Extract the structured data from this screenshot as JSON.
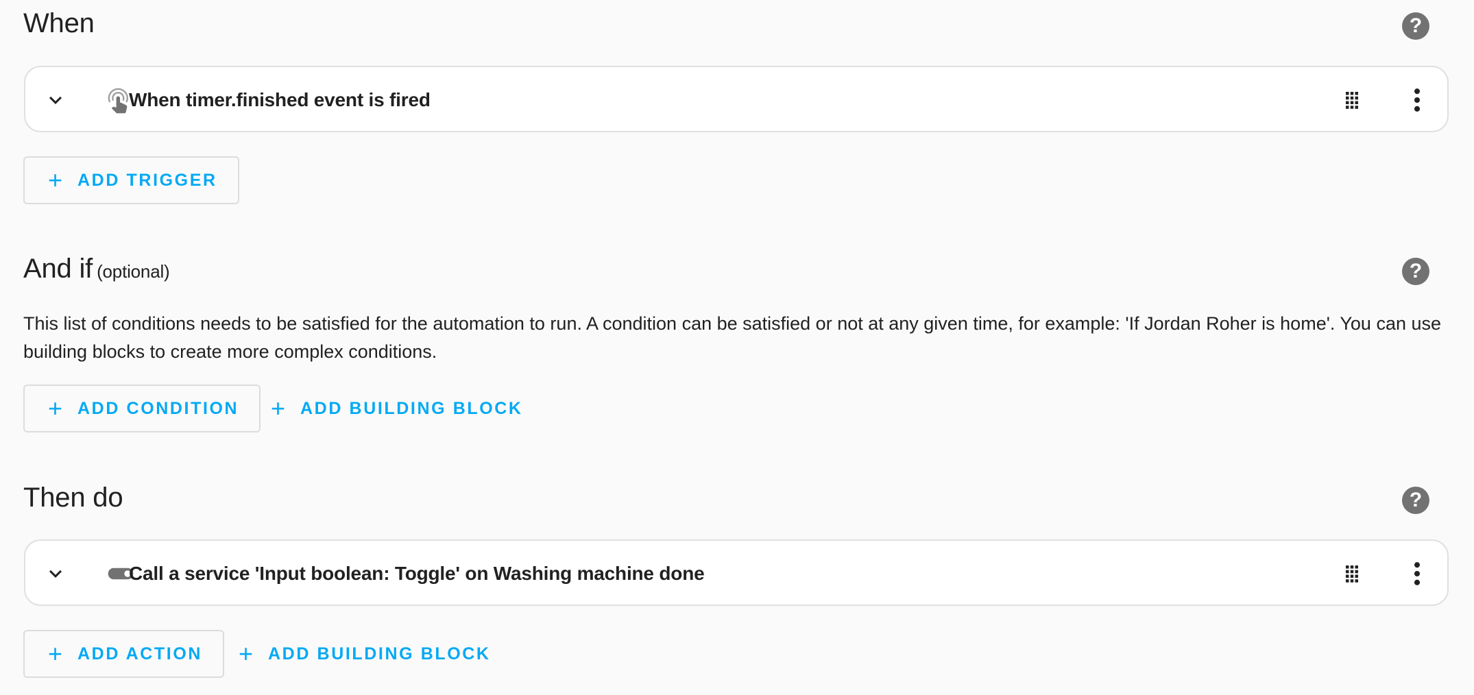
{
  "triggers_section": {
    "title": "When",
    "help_icon": "help-circle-icon",
    "items": [
      {
        "icon": "gesture-tap-icon",
        "label": "When timer.finished event is fired"
      }
    ],
    "add_button": {
      "icon": "plus-icon",
      "label": "ADD TRIGGER"
    }
  },
  "conditions_section": {
    "title": "And if",
    "subtitle": "(optional)",
    "help_icon": "help-circle-icon",
    "description": "This list of conditions needs to be satisfied for the automation to run. A condition can be satisfied or not at any given time, for example: 'If Jordan Roher is home'. You can use building blocks to create more complex conditions.",
    "add_button": {
      "icon": "plus-icon",
      "label": "ADD CONDITION"
    },
    "add_block_button": {
      "icon": "plus-icon",
      "label": "ADD BUILDING BLOCK"
    }
  },
  "actions_section": {
    "title": "Then do",
    "help_icon": "help-circle-icon",
    "items": [
      {
        "icon": "toggle-switch-icon",
        "label": "Call a service 'Input boolean: Toggle' on Washing machine done"
      }
    ],
    "add_button": {
      "icon": "plus-icon",
      "label": "ADD ACTION"
    },
    "add_block_button": {
      "icon": "plus-icon",
      "label": "ADD BUILDING BLOCK"
    }
  },
  "common": {
    "help_glyph": "?",
    "plus_glyph": "+"
  },
  "colors": {
    "accent": "#03a9f4",
    "background": "#fafafa",
    "card_background": "#ffffff",
    "card_border": "#e0e0e0",
    "icon_grey": "#727272",
    "text_primary": "#212121"
  }
}
